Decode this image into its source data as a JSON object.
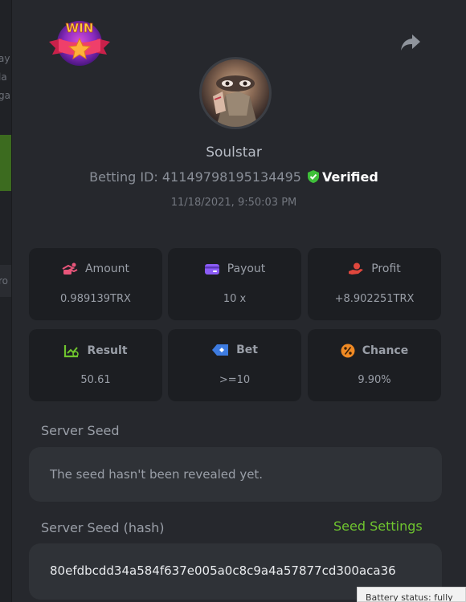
{
  "backdrop": {
    "text_fragments": [
      "ay",
      "la",
      "ga",
      "ro"
    ]
  },
  "header": {
    "logo_text": "WIN",
    "share_icon": "share-arrow-icon"
  },
  "profile": {
    "username": "Soulstar",
    "betting_id_label": "Betting ID:",
    "betting_id": "41149798195134495",
    "verified_label": "Verified",
    "timestamp": "11/18/2021, 9:50:03 PM"
  },
  "stats": [
    {
      "label": "Amount",
      "value": "0.989139TRX",
      "icon": "amount-icon",
      "color": "#e8557a"
    },
    {
      "label": "Payout",
      "value": "10 x",
      "icon": "payout-icon",
      "color": "#8b5cf6"
    },
    {
      "label": "Profit",
      "value": "+8.902251TRX",
      "icon": "profit-icon",
      "color": "#e0473d"
    },
    {
      "label": "Result",
      "value": "50.61",
      "icon": "result-icon",
      "color": "#6fc52e"
    },
    {
      "label": "Bet",
      "value": ">=10",
      "icon": "bet-icon",
      "color": "#3d7be0"
    },
    {
      "label": "Chance",
      "value": "9.90%",
      "icon": "chance-icon",
      "color": "#f08a24"
    }
  ],
  "server_seed": {
    "label": "Server Seed",
    "value": "The seed hasn't been revealed yet."
  },
  "server_seed_hash": {
    "label": "Server Seed (hash)",
    "settings_link": "Seed Settings",
    "value": "80efdbcdd34a584f637e005a0c8c9a4a57877cd300aca36"
  },
  "tooltip": {
    "text": "Battery status: fully"
  },
  "colors": {
    "accent_green": "#6fc52e",
    "modal_bg": "#26282d",
    "card_bg": "#1c1e22"
  }
}
